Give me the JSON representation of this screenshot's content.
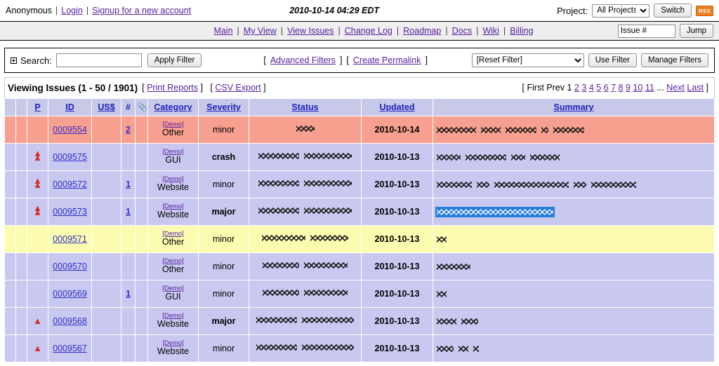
{
  "header": {
    "user": "Anonymous",
    "login_label": "Login",
    "signup_label": "Signup for a new account",
    "datetime": "2010-10-14 04:29 EDT",
    "project_label": "Project:",
    "project_selected": "All Projects",
    "project_options": [
      "All Projects"
    ],
    "switch_label": "Switch",
    "rss_label": "RSS"
  },
  "nav": {
    "items": [
      {
        "label": "Main"
      },
      {
        "label": "My View"
      },
      {
        "label": "View Issues"
      },
      {
        "label": "Change Log"
      },
      {
        "label": "Roadmap"
      },
      {
        "label": "Docs"
      },
      {
        "label": "Wiki"
      },
      {
        "label": "Billing"
      }
    ],
    "issue_placeholder": "Issue #",
    "issue_value": "",
    "jump_label": "Jump"
  },
  "filter": {
    "search_label": "Search:",
    "search_value": "",
    "apply_label": "Apply Filter",
    "advanced_label": "Advanced Filters",
    "permalink_label": "Create Permalink",
    "bracket_open": "[",
    "bracket_close": "]",
    "saved_filter_selected": "[Reset Filter]",
    "saved_filter_options": [
      "[Reset Filter]"
    ],
    "use_filter_label": "Use Filter",
    "manage_filters_label": "Manage Filters"
  },
  "issues": {
    "caption": "Viewing Issues (1 - 50 / 1901)",
    "print_reports_label": "Print Reports",
    "csv_export_label": "CSV Export",
    "pager": {
      "open": "[",
      "first": "First",
      "prev": "Prev",
      "current": "1",
      "pages": [
        "2",
        "3",
        "4",
        "5",
        "6",
        "7",
        "8",
        "9",
        "10",
        "11"
      ],
      "ellipsis": "...",
      "next": "Next",
      "last": "Last",
      "close": "]"
    },
    "columns": [
      {
        "label": "",
        "name": "checkbox-col"
      },
      {
        "label": "",
        "name": "flag-col"
      },
      {
        "label": "P",
        "name": "priority-col"
      },
      {
        "label": "ID",
        "name": "id-col"
      },
      {
        "label": "US$",
        "name": "cost-col"
      },
      {
        "label": "#",
        "name": "notes-col"
      },
      {
        "label": "",
        "name": "attachment-col"
      },
      {
        "label": "Category",
        "name": "category-col"
      },
      {
        "label": "Severity",
        "name": "severity-col"
      },
      {
        "label": "Status",
        "name": "status-col"
      },
      {
        "label": "Updated",
        "name": "updated-col"
      },
      {
        "label": "Summary",
        "name": "summary-col"
      }
    ],
    "demo_label": "[Demo]",
    "rows": [
      {
        "row_color": "pink",
        "priority": "none",
        "id": "0009554",
        "cost": "",
        "notes": "2",
        "project": "[Demo]",
        "category": "Other",
        "severity": "minor",
        "severity_bold": false,
        "status_blob_widths": [
          26
        ],
        "updated": "2010-10-14",
        "summary_blob_widths": [
          56,
          28,
          44,
          10,
          44
        ]
      },
      {
        "row_color": "normal",
        "priority": "high",
        "id": "0009575",
        "cost": "",
        "notes": "",
        "project": "[Demo]",
        "category": "GUI",
        "severity": "crash",
        "severity_bold": true,
        "status_blob_widths": [
          58,
          68
        ],
        "updated": "2010-10-13",
        "summary_blob_widths": [
          34,
          58,
          20,
          42
        ]
      },
      {
        "row_color": "normal",
        "priority": "high",
        "id": "0009572",
        "cost": "",
        "notes": "1",
        "project": "[Demo]",
        "category": "Website",
        "severity": "minor",
        "severity_bold": false,
        "status_blob_widths": [
          58,
          68
        ],
        "updated": "2010-10-13",
        "summary_blob_widths": [
          50,
          18,
          106,
          18,
          64
        ]
      },
      {
        "row_color": "normal",
        "priority": "high",
        "id": "0009573",
        "cost": "",
        "notes": "1",
        "project": "[Demo]",
        "category": "Website",
        "severity": "major",
        "severity_bold": true,
        "status_blob_widths": [
          58,
          68
        ],
        "updated": "2010-10-13",
        "summary_selected": true,
        "summary_blob_widths": [
          166
        ]
      },
      {
        "row_color": "yellow",
        "priority": "none",
        "id": "0009571",
        "cost": "",
        "notes": "",
        "project": "[Demo]",
        "category": "Other",
        "severity": "minor",
        "severity_bold": false,
        "status_blob_widths": [
          62,
          54
        ],
        "updated": "2010-10-13",
        "summary_blob_widths": [
          14
        ]
      },
      {
        "row_color": "normal",
        "priority": "none",
        "id": "0009570",
        "cost": "",
        "notes": "",
        "project": "[Demo]",
        "category": "Other",
        "severity": "minor",
        "severity_bold": false,
        "status_blob_widths": [
          52,
          62
        ],
        "updated": "2010-10-13",
        "summary_blob_widths": [
          48
        ]
      },
      {
        "row_color": "normal",
        "priority": "none",
        "id": "0009569",
        "cost": "",
        "notes": "1",
        "project": "[Demo]",
        "category": "GUI",
        "severity": "minor",
        "severity_bold": false,
        "status_blob_widths": [
          52,
          62
        ],
        "updated": "2010-10-13",
        "summary_blob_widths": [
          14
        ]
      },
      {
        "row_color": "normal",
        "priority": "normal",
        "id": "0009568",
        "cost": "",
        "notes": "",
        "project": "[Demo]",
        "category": "Website",
        "severity": "major",
        "severity_bold": true,
        "status_blob_widths": [
          58,
          74
        ],
        "updated": "2010-10-13",
        "summary_blob_widths": [
          28,
          24
        ]
      },
      {
        "row_color": "normal",
        "priority": "normal",
        "id": "0009567",
        "cost": "",
        "notes": "",
        "project": "[Demo]",
        "category": "Website",
        "severity": "minor",
        "severity_bold": false,
        "status_blob_widths": [
          58,
          74
        ],
        "updated": "2010-10-13",
        "summary_blob_widths": [
          24,
          14,
          8
        ]
      }
    ]
  },
  "colors": {
    "row_normal": "#c8c8f0",
    "row_pink": "#f8a090",
    "row_yellow": "#fcfcb0",
    "header_bg": "#c8c8e8",
    "link": "#5a20a0",
    "link_blue": "#2020c0",
    "rss": "#f08020",
    "selection": "#1878d8",
    "priority_arrow": "#d03030"
  }
}
